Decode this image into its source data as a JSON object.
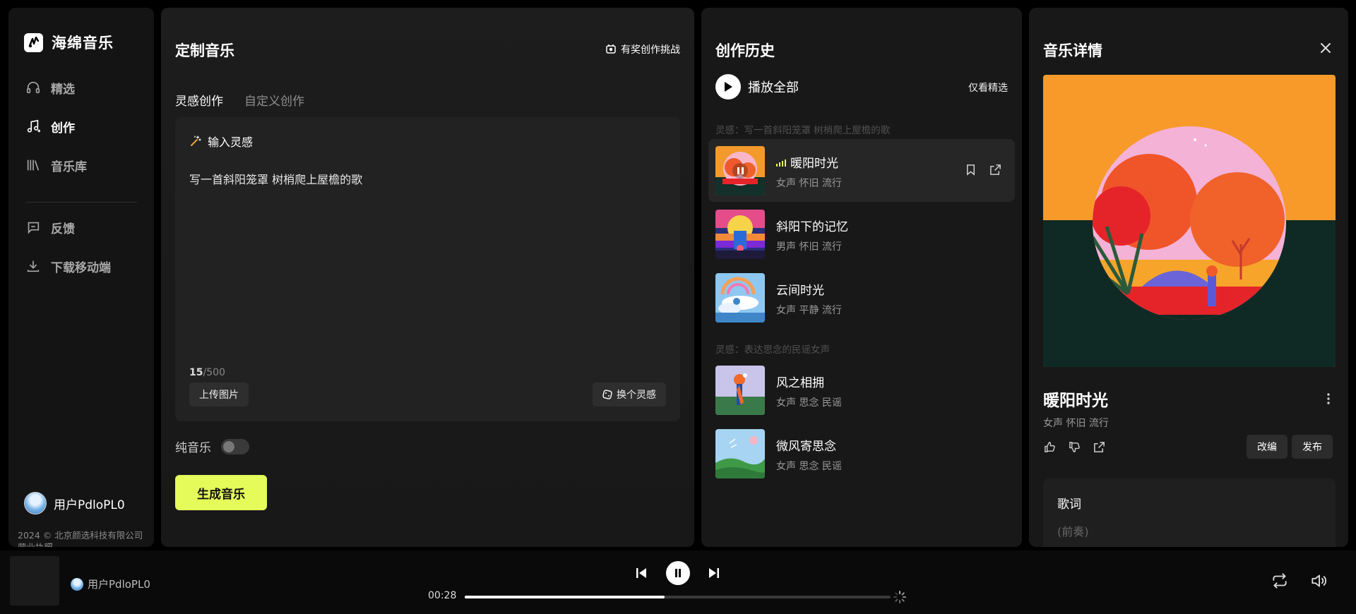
{
  "brand": {
    "name": "海绵音乐"
  },
  "sidebar": {
    "items": [
      {
        "label": "精选",
        "icon": "headphones-icon"
      },
      {
        "label": "创作",
        "icon": "music-note-icon",
        "active": true
      },
      {
        "label": "音乐库",
        "icon": "library-icon"
      },
      {
        "label": "反馈",
        "icon": "feedback-icon"
      },
      {
        "label": "下载移动端",
        "icon": "download-icon"
      }
    ],
    "user": "用户PdloPL0",
    "footer_line1": "2024 © 北京颜选科技有限公司",
    "footer_line2": "营业执照"
  },
  "create": {
    "title": "定制音乐",
    "challenge": "有奖创作挑战",
    "tabs": [
      "灵感创作",
      "自定义创作"
    ],
    "prompt_label": "输入灵感",
    "prompt_text": "写一首斜阳笼罩 树梢爬上屋檐的歌",
    "count_current": "15",
    "count_max": "/500",
    "upload_btn": "上传图片",
    "shuffle_btn": "换个灵感",
    "pure_music_label": "纯音乐",
    "pure_music_on": false,
    "generate_btn": "生成音乐"
  },
  "history": {
    "title": "创作历史",
    "play_all": "播放全部",
    "only_picks": "仅看精选",
    "groups": [
      {
        "label": "灵感：写一首斜阳笼罩 树梢爬上屋檐的歌",
        "songs": [
          {
            "title": "暖阳时光",
            "tags": "女声 怀旧 流行",
            "playing": true
          },
          {
            "title": "斜阳下的记忆",
            "tags": "男声 怀旧 流行"
          },
          {
            "title": "云间时光",
            "tags": "女声 平静 流行"
          }
        ]
      },
      {
        "label": "灵感：表达思念的民谣女声",
        "songs": [
          {
            "title": "风之相拥",
            "tags": "女声 思念 民谣"
          },
          {
            "title": "微风寄思念",
            "tags": "女声 思念 民谣"
          }
        ]
      }
    ]
  },
  "detail": {
    "title": "音乐详情",
    "song_title": "暖阳时光",
    "tags": "女声 怀旧 流行",
    "remix_btn": "改编",
    "publish_btn": "发布",
    "lyrics_title": "歌词",
    "lyrics_first": "(前奏)"
  },
  "player": {
    "user": "用户PdloPL0",
    "time": "00:28",
    "progress": 0.47
  }
}
